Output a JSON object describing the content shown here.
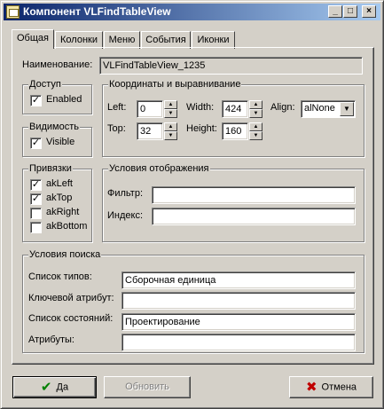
{
  "window": {
    "title": "Компонент VLFindTableView",
    "controls": [
      "_",
      "□",
      "×"
    ]
  },
  "tabs": [
    {
      "label": "Общая",
      "active": true
    },
    {
      "label": "Колонки",
      "active": false
    },
    {
      "label": "Меню",
      "active": false
    },
    {
      "label": "События",
      "active": false
    },
    {
      "label": "Иконки",
      "active": false
    }
  ],
  "general": {
    "name_label": "Наименование:",
    "name_value": "VLFindTableView_1235"
  },
  "access": {
    "title": "Доступ",
    "enabled_label": "Enabled",
    "enabled_checked": true
  },
  "visibility": {
    "title": "Видимость",
    "visible_label": "Visible",
    "visible_checked": true
  },
  "coords": {
    "title": "Координаты и выравнивание",
    "left_label": "Left:",
    "left_value": "0",
    "top_label": "Top:",
    "top_value": "32",
    "width_label": "Width:",
    "width_value": "424",
    "height_label": "Height:",
    "height_value": "160",
    "align_label": "Align:",
    "align_value": "alNone"
  },
  "anchors": {
    "title": "Привязки",
    "items": [
      {
        "label": "akLeft",
        "checked": true
      },
      {
        "label": "akTop",
        "checked": true
      },
      {
        "label": "akRight",
        "checked": false
      },
      {
        "label": "akBottom",
        "checked": false
      }
    ]
  },
  "display": {
    "title": "Условия отображения",
    "filter_label": "Фильтр:",
    "filter_value": "",
    "index_label": "Индекс:",
    "index_value": ""
  },
  "search": {
    "title": "Условия поиска",
    "types_label": "Список типов:",
    "types_value": "Сборочная единица",
    "key_label": "Ключевой атрибут:",
    "key_value": "",
    "states_label": "Список состояний:",
    "states_value": "Проектирование",
    "attrs_label": "Атрибуты:",
    "attrs_value": ""
  },
  "buttons": {
    "ok": "Да",
    "refresh": "Обновить",
    "cancel": "Отмена",
    "ok_icon_color": "#008000",
    "cancel_icon_color": "#c00000"
  }
}
